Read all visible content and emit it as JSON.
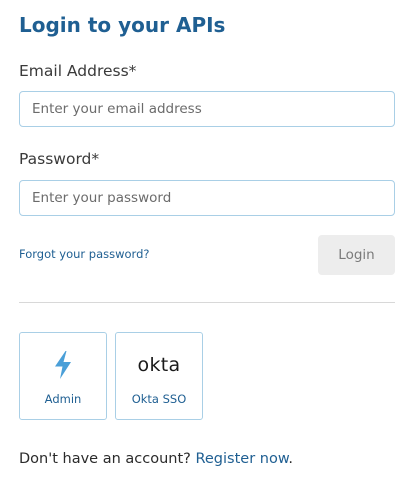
{
  "page": {
    "title": "Login to your APIs"
  },
  "form": {
    "email_label": "Email Address*",
    "email_placeholder": "Enter your email address",
    "email_value": "",
    "password_label": "Password*",
    "password_placeholder": "Enter your password",
    "password_value": "",
    "forgot_link": "Forgot your password?",
    "login_button": "Login"
  },
  "sso": {
    "providers": [
      {
        "label": "Admin",
        "icon": "lightning-bolt-icon"
      },
      {
        "label": "Okta SSO",
        "icon": "okta-logo",
        "logo_text": "okta"
      }
    ]
  },
  "register": {
    "prompt": "Don't have an account?",
    "link": "Register now",
    "suffix": "."
  },
  "colors": {
    "accent": "#1f5f92",
    "input_border": "#a9cfe6",
    "icon_blue": "#4a9fd8",
    "button_bg": "#ededed"
  }
}
